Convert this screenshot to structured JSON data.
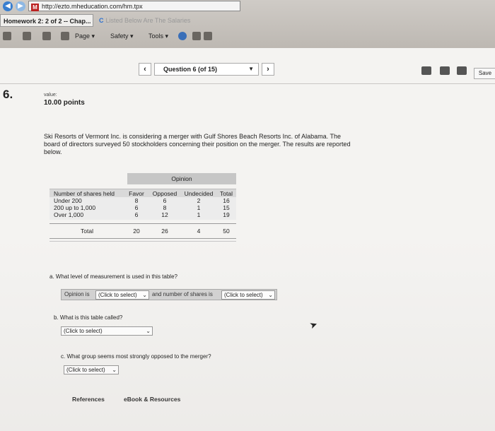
{
  "browser": {
    "url": "http://ezto.mheducation.com/hm.tpx",
    "active_tab": "Homework 2: 2 of 2 -- Chap...",
    "active_tab_close": "×",
    "inactive_tab": "Listed Below Are The Salaries",
    "commands": {
      "page": "Page ▾",
      "safety": "Safety ▾",
      "tools": "Tools ▾"
    }
  },
  "nav": {
    "prev": "‹",
    "question_selector": "Question 6 (of 15)",
    "next": "›",
    "save": "Save"
  },
  "question": {
    "number": "6.",
    "value_label": "value:",
    "points": "10.00 points",
    "prompt": "Ski Resorts of Vermont Inc. is considering a merger with Gulf Shores Beach Resorts Inc. of Alabama. The board of directors surveyed 50 stockholders concerning their position on the merger. The results are reported below."
  },
  "table": {
    "group_header": "Opinion",
    "columns": [
      "Number of shares held",
      "Favor",
      "Opposed",
      "Undecided",
      "Total"
    ],
    "rows": [
      [
        "Under 200",
        "8",
        "6",
        "2",
        "16"
      ],
      [
        "200 up to 1,000",
        "6",
        "8",
        "1",
        "15"
      ],
      [
        "Over 1,000",
        "6",
        "12",
        "1",
        "19"
      ]
    ],
    "total_row": [
      "Total",
      "20",
      "26",
      "4",
      "50"
    ]
  },
  "parts": {
    "a": {
      "question": "a. What level of measurement is used in this table?",
      "prefix1": "Opinion is",
      "select1": "(Click to select)",
      "middle": "and number of shares is",
      "select2": "(Click to select)"
    },
    "b": {
      "question": "b. What is this table called?",
      "select": "(Click to select)"
    },
    "c": {
      "question": "c. What group seems most strongly opposed to the merger?",
      "select": "(Click to select)"
    }
  },
  "footer": {
    "references": "References",
    "ebook": "eBook & Resources"
  },
  "colors": {
    "chrome": "#c8c4bf",
    "page_bg": "#f4f3f1",
    "table_header": "#c6c6c6",
    "answer_box": "#d3d3d3"
  }
}
